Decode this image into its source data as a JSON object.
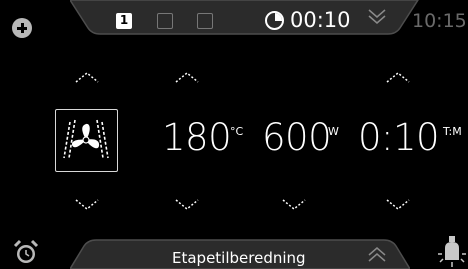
{
  "top": {
    "steps": [
      {
        "label": "1",
        "active": true
      },
      {
        "label": "",
        "active": false
      },
      {
        "label": "",
        "active": false
      }
    ],
    "timer_icon": "timer-icon",
    "timer_value": "00:10",
    "expand_icon": "chevron-double-down-icon",
    "clock": "10:15",
    "add_icon": "plus-icon"
  },
  "main": {
    "mode_icon": "fan-icon",
    "temperature": {
      "value": "180",
      "unit": "°C"
    },
    "power": {
      "value": "600",
      "unit": "W"
    },
    "time": {
      "value": "0:10",
      "unit": "T:M"
    }
  },
  "bottom": {
    "label": "Etapetilberedning",
    "collapse_icon": "chevron-double-up-icon",
    "alarm_icon": "alarm-icon",
    "lamp_icon": "lamp-icon"
  },
  "colors": {
    "background": "#000000",
    "tab": "#2e2e2e",
    "tab_border": "#555555",
    "text": "#ffffff",
    "muted": "#6a6a6a"
  }
}
